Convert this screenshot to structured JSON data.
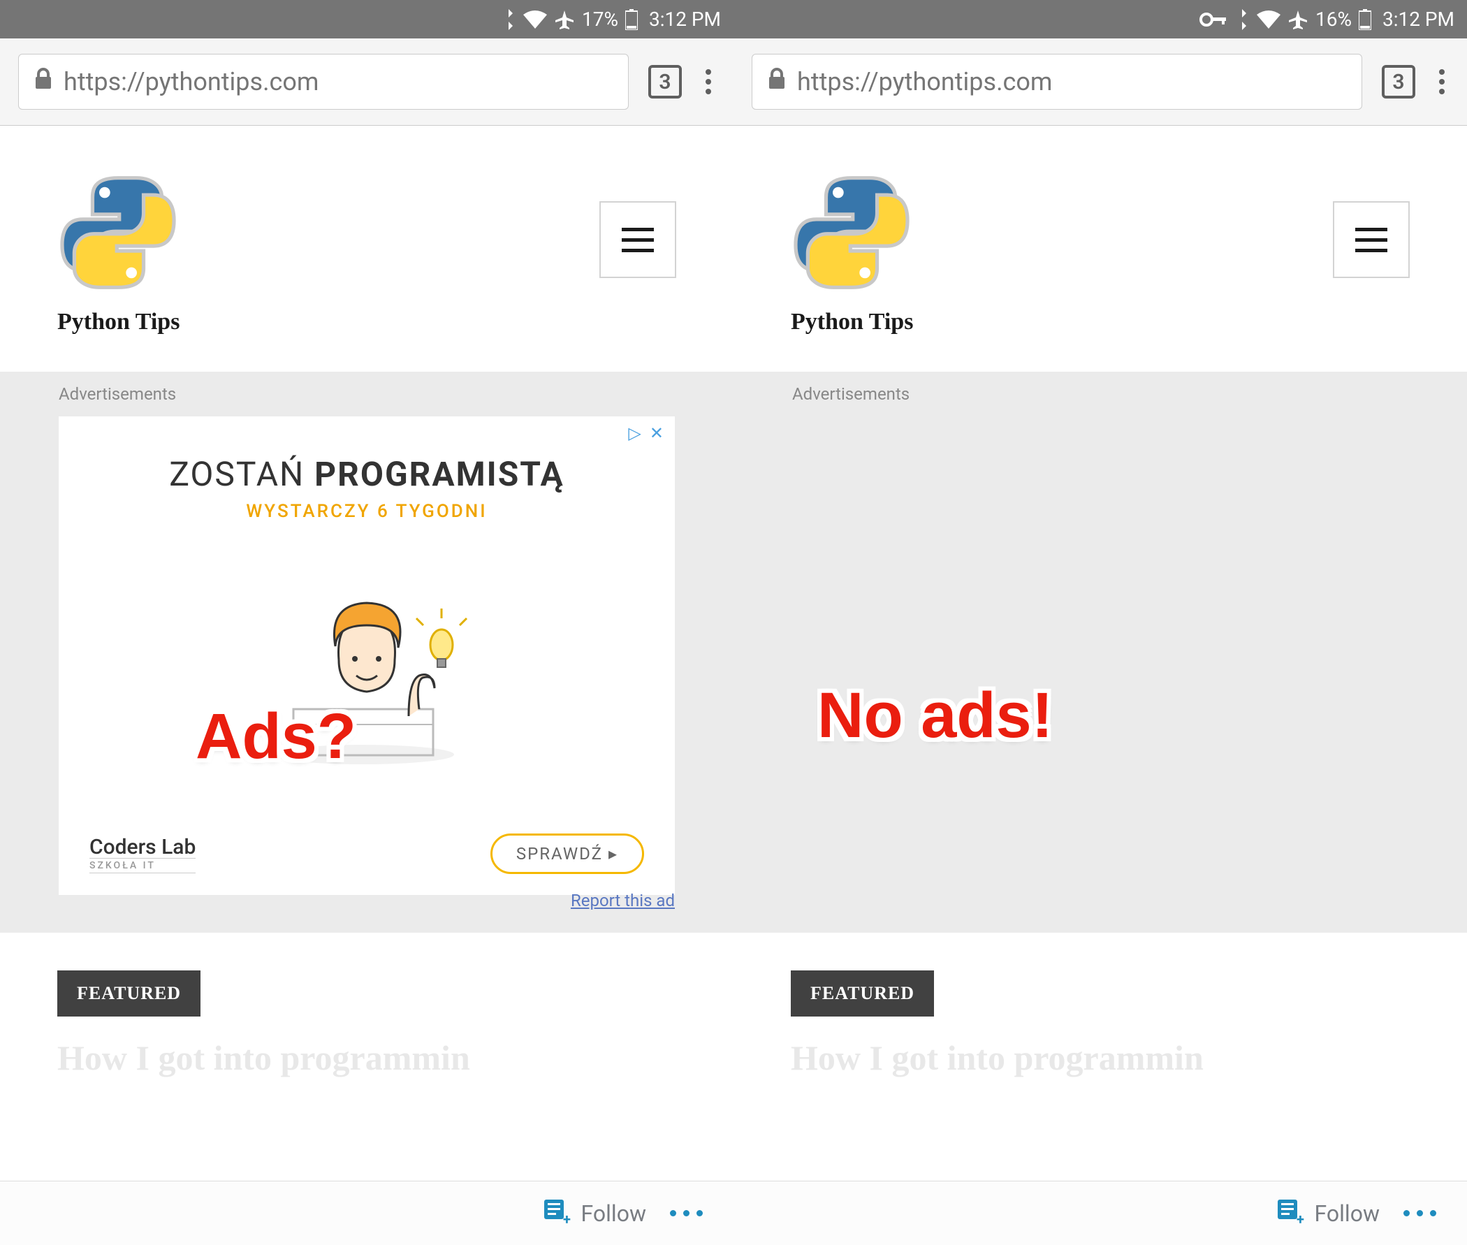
{
  "left": {
    "status": {
      "battery": "17%",
      "time": "3:12 PM",
      "vpn": false
    },
    "url": "https://pythontips.com",
    "tabs": "3",
    "site_title": "Python Tips",
    "ads_label": "Advertisements",
    "ad": {
      "headline_pre": "ZOSTAŃ ",
      "headline_bold": "PROGRAMISTĄ",
      "subhead": "WYSTARCZY 6 TYGODNI",
      "brand": "Coders Lab",
      "brand_sub": "SZKOŁA IT",
      "cta": "SPRAWDŹ ▸",
      "report": "Report this ad"
    },
    "sticker": "Ads?",
    "featured": "FEATURED",
    "article": "How I got into programmin",
    "follow": "Follow"
  },
  "right": {
    "status": {
      "battery": "16%",
      "time": "3:12 PM",
      "vpn": true
    },
    "url": "https://pythontips.com",
    "tabs": "3",
    "site_title": "Python Tips",
    "ads_label": "Advertisements",
    "sticker": "No ads!",
    "featured": "FEATURED",
    "article": "How I got into programmin",
    "follow": "Follow"
  }
}
